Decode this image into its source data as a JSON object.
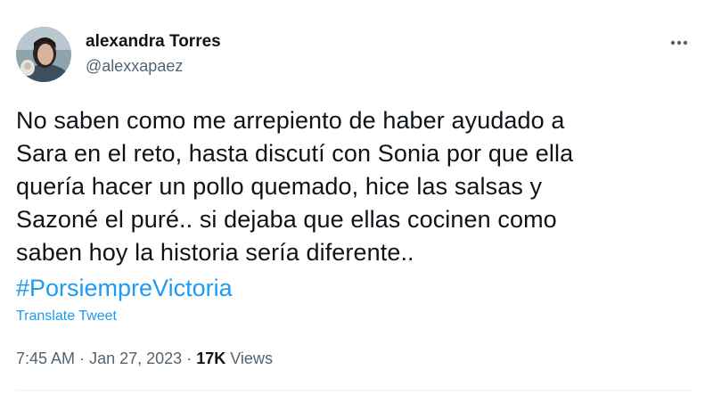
{
  "author": {
    "name": "alexandra Torres",
    "handle": "@alexxapaez"
  },
  "tweet": {
    "lines": [
      "No saben como me arrepiento de haber ayudado a",
      "Sara en el reto, hasta discutí con Sonia por que ella",
      "quería hacer un pollo quemado, hice las salsas y",
      "Sazoné el puré.. si dejaba que ellas cocinen como",
      "saben hoy la historia sería diferente.."
    ],
    "hashtag": "#PorsiempreVictoria",
    "translate_label": "Translate Tweet"
  },
  "meta": {
    "time": "7:45 AM",
    "separator": "·",
    "date": "Jan 27, 2023",
    "views_count": "17K",
    "views_label": "Views"
  },
  "icons": {
    "more": "more-options-icon",
    "avatar": "avatar"
  },
  "colors": {
    "link": "#1d9bf0",
    "secondary_text": "#536471",
    "primary_text": "#0f1419"
  }
}
